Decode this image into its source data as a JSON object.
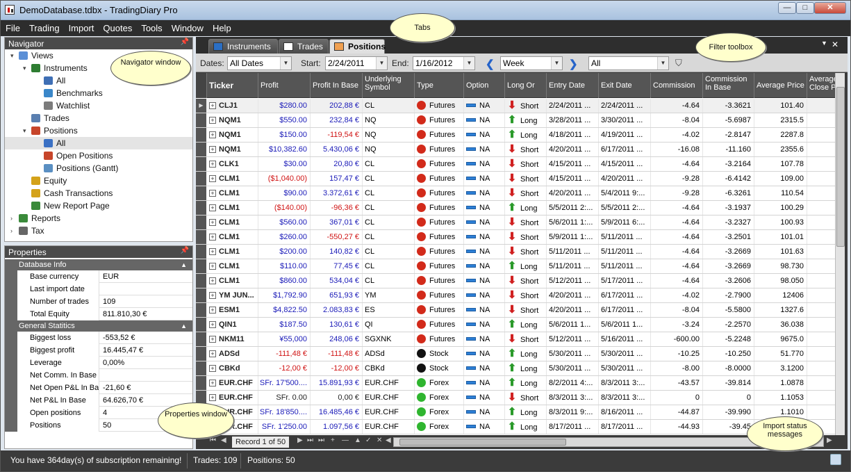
{
  "app": {
    "title": "DemoDatabase.tdbx - TradingDiary Pro"
  },
  "window_controls": {
    "minimize": "—",
    "maximize": "□",
    "close": "✕"
  },
  "menu": [
    "File",
    "Trading",
    "Import",
    "Quotes",
    "Tools",
    "Window",
    "Help"
  ],
  "navigator": {
    "title": "Navigator",
    "items": [
      {
        "label": "Views",
        "indent": 0,
        "toggle": "▾",
        "icon": "views-icon"
      },
      {
        "label": "Instruments",
        "indent": 1,
        "toggle": "▾",
        "icon": "instruments-icon"
      },
      {
        "label": "All",
        "indent": 2,
        "toggle": "",
        "icon": "all-instruments-icon"
      },
      {
        "label": "Benchmarks",
        "indent": 2,
        "toggle": "",
        "icon": "benchmarks-icon"
      },
      {
        "label": "Watchlist",
        "indent": 2,
        "toggle": "",
        "icon": "watchlist-icon"
      },
      {
        "label": "Trades",
        "indent": 1,
        "toggle": "",
        "icon": "trades-icon"
      },
      {
        "label": "Positions",
        "indent": 1,
        "toggle": "▾",
        "icon": "positions-icon"
      },
      {
        "label": "All",
        "indent": 2,
        "toggle": "",
        "icon": "all-positions-icon",
        "selected": true
      },
      {
        "label": "Open Positions",
        "indent": 2,
        "toggle": "",
        "icon": "open-positions-icon"
      },
      {
        "label": "Positions (Gantt)",
        "indent": 2,
        "toggle": "",
        "icon": "gantt-icon"
      },
      {
        "label": "Equity",
        "indent": 1,
        "toggle": "",
        "icon": "equity-icon"
      },
      {
        "label": "Cash Transactions",
        "indent": 1,
        "toggle": "",
        "icon": "cash-icon"
      },
      {
        "label": "New Report Page",
        "indent": 1,
        "toggle": "",
        "icon": "report-page-icon"
      },
      {
        "label": "Reports",
        "indent": 0,
        "toggle": "›",
        "icon": "reports-icon"
      },
      {
        "label": "Tax",
        "indent": 0,
        "toggle": "›",
        "icon": "tax-icon"
      }
    ]
  },
  "properties": {
    "title": "Properties",
    "groups": [
      {
        "name": "Database Info",
        "rows": [
          {
            "k": "Base currency",
            "v": "EUR"
          },
          {
            "k": "Last import date",
            "v": ""
          },
          {
            "k": "Number of trades",
            "v": "109"
          },
          {
            "k": "Total Equity",
            "v": "811.810,30 €"
          }
        ]
      },
      {
        "name": "General Statitics",
        "rows": [
          {
            "k": "Biggest loss",
            "v": "-553,52 €"
          },
          {
            "k": "Biggest profit",
            "v": "16.445,47 €"
          },
          {
            "k": "Leverage",
            "v": "0,00%"
          },
          {
            "k": "Net Comm. In Base",
            "v": ""
          },
          {
            "k": "Net Open P&L In Base",
            "v": "-21,60 €"
          },
          {
            "k": "Net P&L In Base",
            "v": "64.626,70 €"
          },
          {
            "k": "Open positions",
            "v": "4"
          },
          {
            "k": "Positions",
            "v": "50"
          }
        ]
      }
    ]
  },
  "tabs": [
    {
      "label": "Instruments",
      "active": false
    },
    {
      "label": "Trades",
      "active": false
    },
    {
      "label": "Positions",
      "active": true
    }
  ],
  "filter": {
    "dates_label": "Dates:",
    "dates_value": "All Dates",
    "start_label": "Start:",
    "start_value": "2/24/2011",
    "end_label": "End:",
    "end_value": "1/16/2012",
    "period_value": "Week",
    "filter_value": "All"
  },
  "columns": [
    "Ticker",
    "Profit",
    "Profit In Base",
    "Underlying Symbol",
    "Type",
    "Option Type",
    "Long Or Short",
    "Entry Date",
    "Exit Date",
    "Commission",
    "Commission In Base",
    "Average Price",
    "Average Close P"
  ],
  "rows": [
    {
      "t": "CLJ1",
      "p": "$280.00",
      "pc": "blue",
      "pb": "202,88 €",
      "pbc": "blue",
      "u": "CL",
      "ty": "Futures",
      "o": "NA",
      "ls": "Short",
      "ed": "2/24/2011 ...",
      "xd": "2/24/2011 ...",
      "c": "-4.64",
      "cb": "-3.3621",
      "ap": "101.40"
    },
    {
      "t": "NQM1",
      "p": "$550.00",
      "pc": "blue",
      "pb": "232,84 €",
      "pbc": "blue",
      "u": "NQ",
      "ty": "Futures",
      "o": "NA",
      "ls": "Long",
      "ed": "3/28/2011 ...",
      "xd": "3/30/2011 ...",
      "c": "-8.04",
      "cb": "-5.6987",
      "ap": "2315.5"
    },
    {
      "t": "NQM1",
      "p": "$150.00",
      "pc": "blue",
      "pb": "-119,54 €",
      "pbc": "red",
      "u": "NQ",
      "ty": "Futures",
      "o": "NA",
      "ls": "Long",
      "ed": "4/18/2011 ...",
      "xd": "4/19/2011 ...",
      "c": "-4.02",
      "cb": "-2.8147",
      "ap": "2287.8"
    },
    {
      "t": "NQM1",
      "p": "$10,382.60",
      "pc": "blue",
      "pb": "5.430,06 €",
      "pbc": "blue",
      "u": "NQ",
      "ty": "Futures",
      "o": "NA",
      "ls": "Short",
      "ed": "4/20/2011 ...",
      "xd": "6/17/2011 ...",
      "c": "-16.08",
      "cb": "-11.160",
      "ap": "2355.6"
    },
    {
      "t": "CLK1",
      "p": "$30.00",
      "pc": "blue",
      "pb": "20,80 €",
      "pbc": "blue",
      "u": "CL",
      "ty": "Futures",
      "o": "NA",
      "ls": "Short",
      "ed": "4/15/2011 ...",
      "xd": "4/15/2011 ...",
      "c": "-4.64",
      "cb": "-3.2164",
      "ap": "107.78"
    },
    {
      "t": "CLM1",
      "p": "($1,040.00)",
      "pc": "red",
      "pb": "157,47 €",
      "pbc": "blue",
      "u": "CL",
      "ty": "Futures",
      "o": "NA",
      "ls": "Short",
      "ed": "4/15/2011 ...",
      "xd": "4/20/2011 ...",
      "c": "-9.28",
      "cb": "-6.4142",
      "ap": "109.00"
    },
    {
      "t": "CLM1",
      "p": "$90.00",
      "pc": "blue",
      "pb": "3.372,61 €",
      "pbc": "blue",
      "u": "CL",
      "ty": "Futures",
      "o": "NA",
      "ls": "Short",
      "ed": "4/20/2011 ...",
      "xd": "5/4/2011 9:...",
      "c": "-9.28",
      "cb": "-6.3261",
      "ap": "110.54"
    },
    {
      "t": "CLM1",
      "p": "($140.00)",
      "pc": "red",
      "pb": "-96,36 €",
      "pbc": "red",
      "u": "CL",
      "ty": "Futures",
      "o": "NA",
      "ls": "Long",
      "ed": "5/5/2011 2:...",
      "xd": "5/5/2011 2:...",
      "c": "-4.64",
      "cb": "-3.1937",
      "ap": "100.29"
    },
    {
      "t": "CLM1",
      "p": "$560.00",
      "pc": "blue",
      "pb": "367,01 €",
      "pbc": "blue",
      "u": "CL",
      "ty": "Futures",
      "o": "NA",
      "ls": "Short",
      "ed": "5/6/2011 1:...",
      "xd": "5/9/2011 6:...",
      "c": "-4.64",
      "cb": "-3.2327",
      "ap": "100.93"
    },
    {
      "t": "CLM1",
      "p": "$260.00",
      "pc": "blue",
      "pb": "-550,27 €",
      "pbc": "red",
      "u": "CL",
      "ty": "Futures",
      "o": "NA",
      "ls": "Short",
      "ed": "5/9/2011 1:...",
      "xd": "5/11/2011 ...",
      "c": "-4.64",
      "cb": "-3.2501",
      "ap": "101.01"
    },
    {
      "t": "CLM1",
      "p": "$200.00",
      "pc": "blue",
      "pb": "140,82 €",
      "pbc": "blue",
      "u": "CL",
      "ty": "Futures",
      "o": "NA",
      "ls": "Short",
      "ed": "5/11/2011 ...",
      "xd": "5/11/2011 ...",
      "c": "-4.64",
      "cb": "-3.2669",
      "ap": "101.63"
    },
    {
      "t": "CLM1",
      "p": "$110.00",
      "pc": "blue",
      "pb": "77,45 €",
      "pbc": "blue",
      "u": "CL",
      "ty": "Futures",
      "o": "NA",
      "ls": "Long",
      "ed": "5/11/2011 ...",
      "xd": "5/11/2011 ...",
      "c": "-4.64",
      "cb": "-3.2669",
      "ap": "98.730"
    },
    {
      "t": "CLM1",
      "p": "$860.00",
      "pc": "blue",
      "pb": "534,04 €",
      "pbc": "blue",
      "u": "CL",
      "ty": "Futures",
      "o": "NA",
      "ls": "Short",
      "ed": "5/12/2011 ...",
      "xd": "5/17/2011 ...",
      "c": "-4.64",
      "cb": "-3.2606",
      "ap": "98.050"
    },
    {
      "t": "YM  JUN...",
      "p": "$1,792.90",
      "pc": "blue",
      "pb": "651,93 €",
      "pbc": "blue",
      "u": "YM",
      "ty": "Futures",
      "o": "NA",
      "ls": "Short",
      "ed": "4/20/2011 ...",
      "xd": "6/17/2011 ...",
      "c": "-4.02",
      "cb": "-2.7900",
      "ap": "12406"
    },
    {
      "t": "ESM1",
      "p": "$4,822.50",
      "pc": "blue",
      "pb": "2.083,83 €",
      "pbc": "blue",
      "u": "ES",
      "ty": "Futures",
      "o": "NA",
      "ls": "Short",
      "ed": "4/20/2011 ...",
      "xd": "6/17/2011 ...",
      "c": "-8.04",
      "cb": "-5.5800",
      "ap": "1327.6"
    },
    {
      "t": "QIN1",
      "p": "$187.50",
      "pc": "blue",
      "pb": "130,61 €",
      "pbc": "blue",
      "u": "QI",
      "ty": "Futures",
      "o": "NA",
      "ls": "Long",
      "ed": "5/6/2011 1...",
      "xd": "5/6/2011 1...",
      "c": "-3.24",
      "cb": "-2.2570",
      "ap": "36.038"
    },
    {
      "t": "NKM11",
      "p": "¥55,000",
      "pc": "blue",
      "pb": "248,06 €",
      "pbc": "blue",
      "u": "SGXNK",
      "ty": "Futures",
      "o": "NA",
      "ls": "Short",
      "ed": "5/12/2011 ...",
      "xd": "5/16/2011 ...",
      "c": "-600.00",
      "cb": "-5.2248",
      "ap": "9675.0"
    },
    {
      "t": "ADSd",
      "p": "-111,48 €",
      "pc": "red",
      "pb": "-111,48 €",
      "pbc": "red",
      "u": "ADSd",
      "ty": "Stock",
      "o": "NA",
      "ls": "Long",
      "ed": "5/30/2011 ...",
      "xd": "5/30/2011 ...",
      "c": "-10.25",
      "cb": "-10.250",
      "ap": "51.770"
    },
    {
      "t": "CBKd",
      "p": "-12,00 €",
      "pc": "red",
      "pb": "-12,00 €",
      "pbc": "red",
      "u": "CBKd",
      "ty": "Stock",
      "o": "NA",
      "ls": "Long",
      "ed": "5/30/2011 ...",
      "xd": "5/30/2011 ...",
      "c": "-8.00",
      "cb": "-8.0000",
      "ap": "3.1200"
    },
    {
      "t": "EUR.CHF",
      "p": "SFr. 17'500....",
      "pc": "blue",
      "pb": "15.891,93 €",
      "pbc": "blue",
      "u": "EUR.CHF",
      "ty": "Forex",
      "o": "NA",
      "ls": "Long",
      "ed": "8/2/2011 4:...",
      "xd": "8/3/2011 3:...",
      "c": "-43.57",
      "cb": "-39.814",
      "ap": "1.0878"
    },
    {
      "t": "EUR.CHF",
      "p": "SFr. 0.00",
      "pc": "dark",
      "pb": "0,00 €",
      "pbc": "dark",
      "u": "EUR.CHF",
      "ty": "Forex",
      "o": "NA",
      "ls": "Short",
      "ed": "8/3/2011 3:...",
      "xd": "8/3/2011 3:...",
      "c": "0",
      "cb": "0",
      "ap": "1.1053"
    },
    {
      "t": "EUR.CHF",
      "p": "SFr. 18'850....",
      "pc": "blue",
      "pb": "16.485,46 €",
      "pbc": "blue",
      "u": "EUR.CHF",
      "ty": "Forex",
      "o": "NA",
      "ls": "Long",
      "ed": "8/3/2011 9:...",
      "xd": "8/16/2011 ...",
      "c": "-44.87",
      "cb": "-39.990",
      "ap": "1.1010"
    },
    {
      "t": "EUR.CHF",
      "p": "SFr. 1'250.00",
      "pc": "blue",
      "pb": "1.097,56 €",
      "pbc": "blue",
      "u": "EUR.CHF",
      "ty": "Forex",
      "o": "NA",
      "ls": "Long",
      "ed": "8/17/2011 ...",
      "xd": "8/17/2011 ...",
      "c": "-44.93",
      "cb": "-39.45",
      "ap": ""
    }
  ],
  "type_colors": {
    "Futures": "#d22a1a",
    "Stock": "#111111",
    "Forex": "#2fb52f"
  },
  "footer": {
    "record": "Record 1 of 50"
  },
  "status": {
    "subscription": "You have 364day(s) of subscription remaining!",
    "trades": "Trades: 109",
    "positions": "Positions: 50"
  },
  "callouts": {
    "tabs": "Tabs",
    "navigator": "Navigator window",
    "filter": "Filter toolbox",
    "properties": "Properties window",
    "import": "Import status messages"
  }
}
